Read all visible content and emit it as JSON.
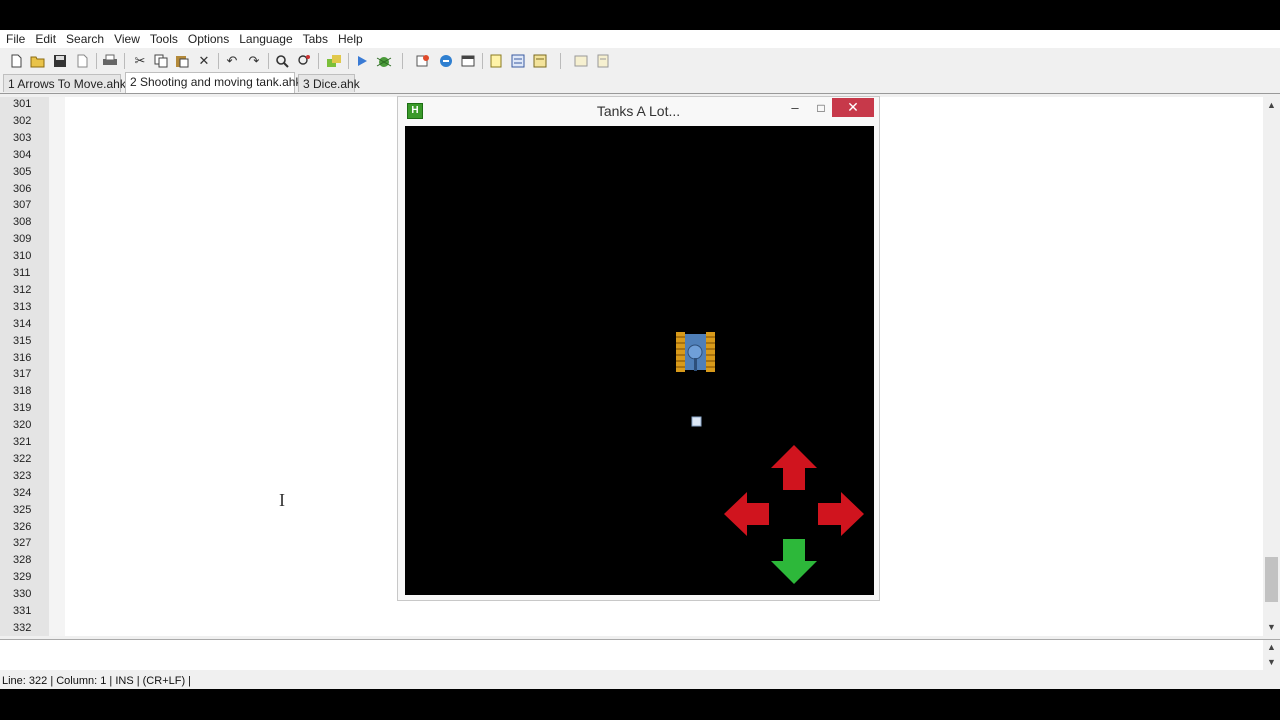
{
  "menu": [
    "File",
    "Edit",
    "Search",
    "View",
    "Tools",
    "Options",
    "Language",
    "Tabs",
    "Help"
  ],
  "toolbar": {
    "icons": [
      "new-file-icon",
      "open-icon",
      "save-icon",
      "close-file-icon",
      "print-icon",
      "cut-icon",
      "copy-icon",
      "paste-icon",
      "delete-icon",
      "undo-icon",
      "redo-icon",
      "find-icon",
      "replace-icon",
      "tools-icon",
      "run-icon",
      "debug-icon",
      "window-spy-icon",
      "compile-icon",
      "gui-icon",
      "open-folder-icon",
      "settings-icon",
      "script-icon",
      "notes-icon",
      "help-icon"
    ]
  },
  "tabs": [
    "1 Arrows To Move.ahk",
    "2 Shooting and moving tank.ahk",
    "3 Dice.ahk"
  ],
  "active_tab": 1,
  "line_numbers": [
    "301",
    "302",
    "303",
    "304",
    "305",
    "306",
    "307",
    "308",
    "309",
    "310",
    "311",
    "312",
    "313",
    "314",
    "315",
    "316",
    "317",
    "318",
    "319",
    "320",
    "321",
    "322",
    "323",
    "324",
    "325",
    "326",
    "327",
    "328",
    "329",
    "330",
    "331",
    "332"
  ],
  "game_window": {
    "title": "Tanks A Lot...",
    "icon_letter": "H",
    "minimize": "–",
    "maximize": "□",
    "close": "✕",
    "arrow_colors": {
      "up": "#d0141e",
      "left": "#d0141e",
      "right": "#d0141e",
      "down": "#2db83a"
    }
  },
  "status": "Line: 322 | Column: 1 | INS | (CR+LF) |"
}
